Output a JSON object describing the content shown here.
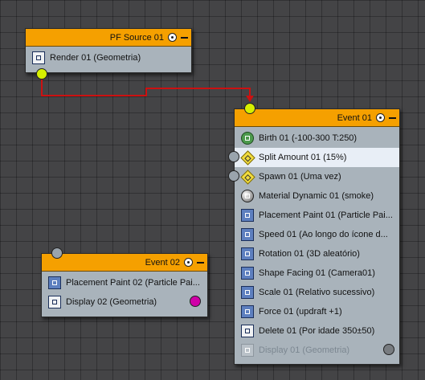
{
  "colors": {
    "header": "#f5a000",
    "node_body": "#a9b3bb",
    "wire": "#cc1111",
    "port_green": "#d7f000",
    "port_magenta": "#d000a8"
  },
  "pf_source": {
    "title": "PF Source 01",
    "operators": [
      {
        "label": "Render 01 (Geometria)",
        "icon": "render-icon"
      }
    ]
  },
  "event01": {
    "title": "Event 01",
    "operators": [
      {
        "label": "Birth 01 (-100-300 T:250)",
        "icon": "birth-icon"
      },
      {
        "label": "Split Amount 01 (15%)",
        "icon": "split-amount-icon"
      },
      {
        "label": "Spawn 01 (Uma vez)",
        "icon": "spawn-icon"
      },
      {
        "label": "Material Dynamic 01 (smoke)",
        "icon": "material-icon"
      },
      {
        "label": "Placement Paint 01 (Particle Pai...",
        "icon": "placement-icon"
      },
      {
        "label": "Speed 01 (Ao longo do ícone d...",
        "icon": "speed-icon"
      },
      {
        "label": "Rotation 01 (3D aleatório)",
        "icon": "rotation-icon"
      },
      {
        "label": "Shape Facing 01 (Camera01)",
        "icon": "shape-facing-icon"
      },
      {
        "label": "Scale 01 (Relativo sucessivo)",
        "icon": "scale-icon"
      },
      {
        "label": "Force 01 (updraft +1)",
        "icon": "force-icon"
      },
      {
        "label": "Delete 01 (Por idade 350±50)",
        "icon": "delete-icon"
      },
      {
        "label": "Display 01 (Geometria)",
        "icon": "display-icon"
      }
    ]
  },
  "event02": {
    "title": "Event 02",
    "operators": [
      {
        "label": "Placement Paint 02 (Particle Pai...",
        "icon": "placement-icon"
      },
      {
        "label": "Display 02 (Geometria)",
        "icon": "display-icon"
      }
    ]
  }
}
